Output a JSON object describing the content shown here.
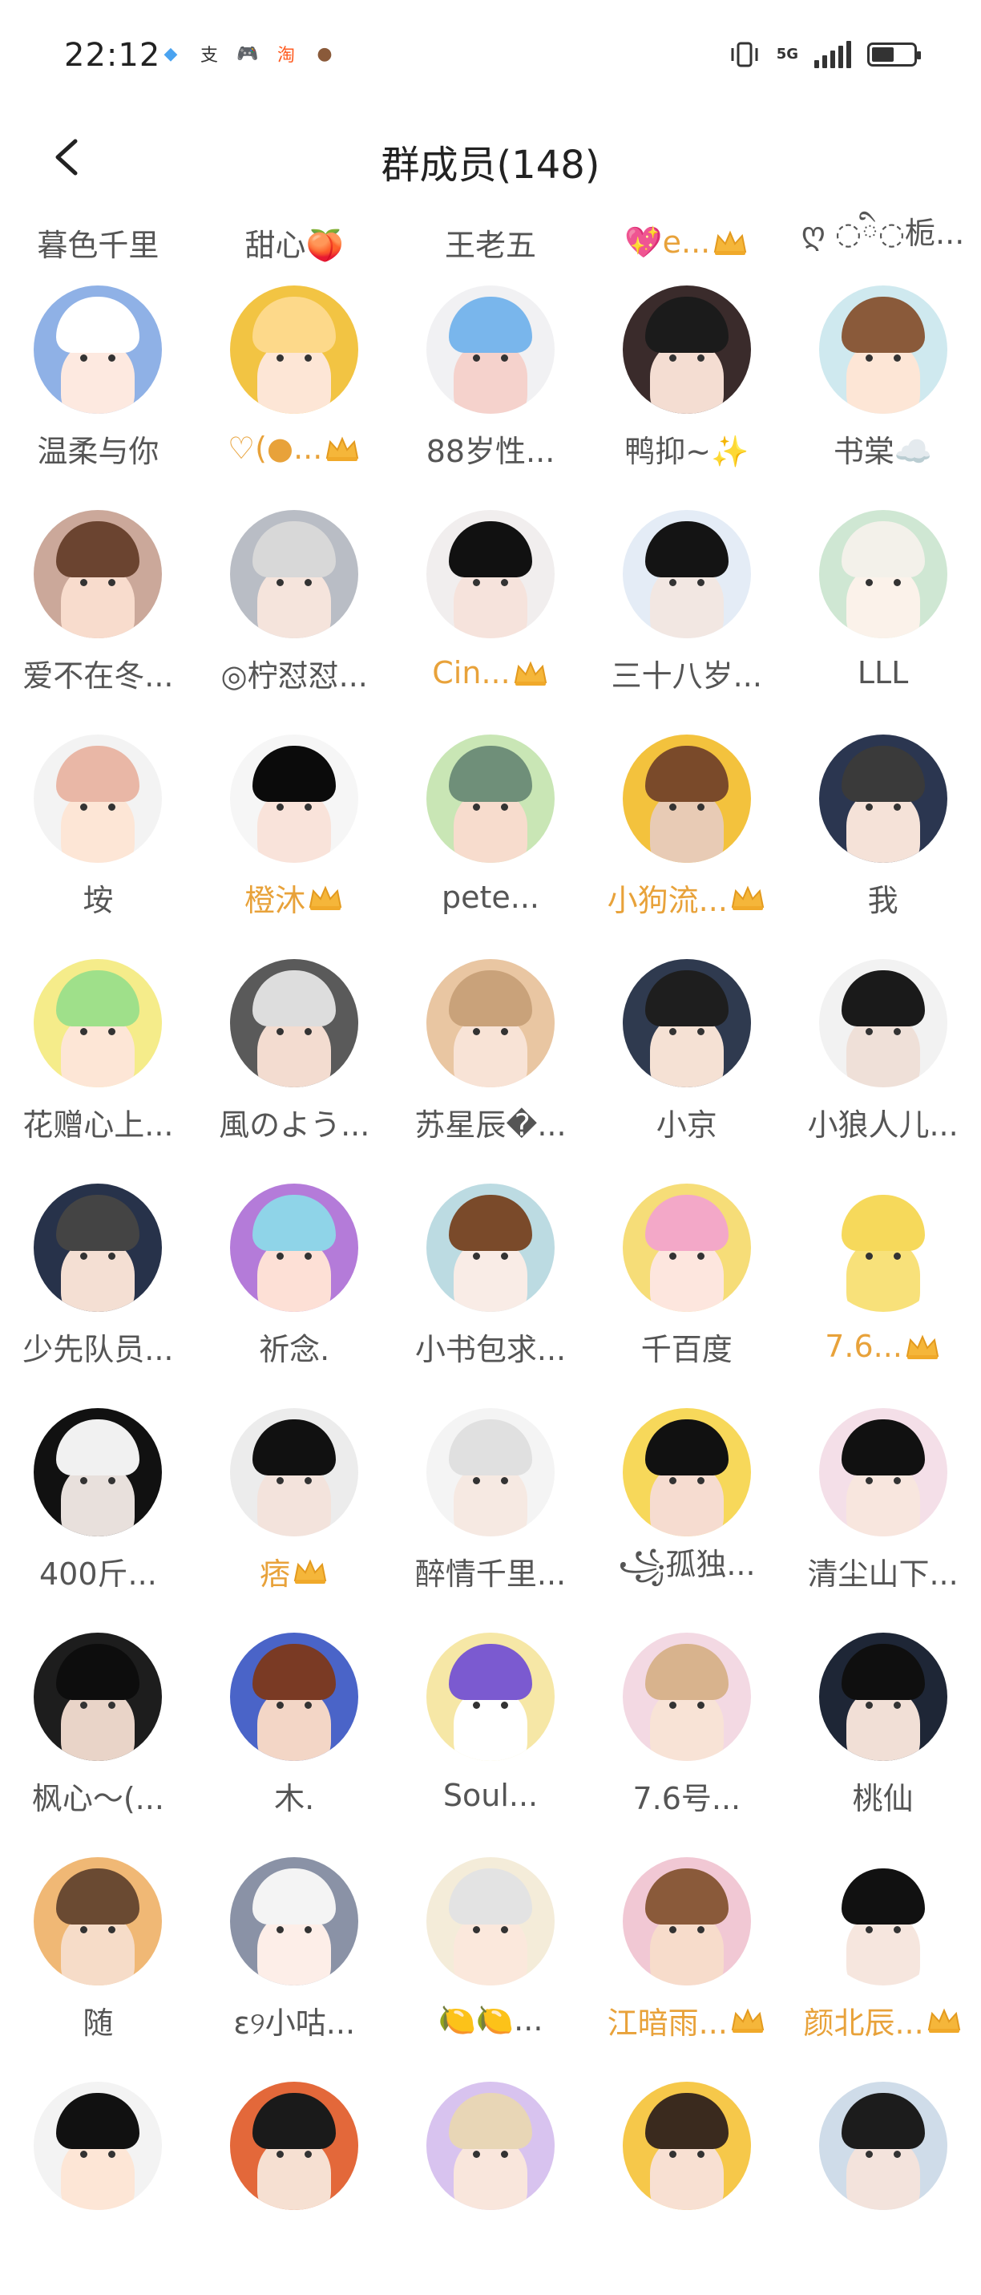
{
  "status": {
    "time": "22:12",
    "network": "5G",
    "apps": [
      {
        "icon": "alipay-mini-icon",
        "glyph": "◆",
        "color": "#4aa3f0"
      },
      {
        "icon": "alipay-icon",
        "glyph": "支",
        "color": "#333333"
      },
      {
        "icon": "game-icon",
        "glyph": "🎮",
        "color": "#6aa8e8"
      },
      {
        "icon": "taobao-icon",
        "glyph": "淘",
        "color": "#ff5a1f"
      },
      {
        "icon": "app-icon",
        "glyph": "●",
        "color": "#8a5a3a"
      }
    ]
  },
  "header": {
    "title": "群成员(148)"
  },
  "top_row": [
    {
      "name": "暮色千里",
      "vip": false
    },
    {
      "name": "甜心🍑",
      "vip": false
    },
    {
      "name": "王老五",
      "vip": false
    },
    {
      "name": "💖e...",
      "vip": true
    },
    {
      "name": "ღ ◌ི◌栀...",
      "vip": false
    }
  ],
  "rows": [
    [
      {
        "name": "温柔与你",
        "vip": false,
        "bg": "#8fb1e6",
        "hair": "#ffffff",
        "skin": "#fde9e0"
      },
      {
        "name": "♡(●...",
        "vip": true,
        "bg": "#f2c443",
        "hair": "#fdd98a",
        "skin": "#fde6d6"
      },
      {
        "name": "88岁性...",
        "vip": false,
        "bg": "#f1f1f3",
        "hair": "#79b6ec",
        "skin": "#f5d2cc"
      },
      {
        "name": "鸭抑~✨",
        "vip": false,
        "bg": "#3a2b2b",
        "hair": "#1b1b1b",
        "skin": "#f4ddd2"
      },
      {
        "name": "书棠☁️",
        "vip": false,
        "bg": "#cfe9ef",
        "hair": "#8a5a3a",
        "skin": "#fde6d6"
      }
    ],
    [
      {
        "name": "爱不在冬...",
        "vip": false,
        "bg": "#cba89a",
        "hair": "#6b4430",
        "skin": "#f8dccd"
      },
      {
        "name": "◎柠怼怼...",
        "vip": false,
        "bg": "#b9bdc5",
        "hair": "#d8d8d8",
        "skin": "#f5e4dc"
      },
      {
        "name": "Cin...",
        "vip": true,
        "bg": "#f1eeee",
        "hair": "#111111",
        "skin": "#f6e3dc"
      },
      {
        "name": "三十八岁...",
        "vip": false,
        "bg": "#e4ecf6",
        "hair": "#141414",
        "skin": "#f2e7e2"
      },
      {
        "name": "LLL",
        "vip": false,
        "bg": "#cfe7d3",
        "hair": "#f3f1ea",
        "skin": "#fbf2ea"
      }
    ],
    [
      {
        "name": "垵",
        "vip": false,
        "bg": "#f3f3f3",
        "hair": "#e9b7a6",
        "skin": "#fde6d6"
      },
      {
        "name": "橙沐",
        "vip": true,
        "bg": "#f6f6f6",
        "hair": "#0b0b0b",
        "skin": "#f9e3da"
      },
      {
        "name": "pete...",
        "vip": false,
        "bg": "#c9e6b5",
        "hair": "#6f8f79",
        "skin": "#f7dccd"
      },
      {
        "name": "小狗流...",
        "vip": true,
        "bg": "#f3c23d",
        "hair": "#7a4a2a",
        "skin": "#e8cbb5"
      },
      {
        "name": "我",
        "vip": false,
        "bg": "#2b3650",
        "hair": "#3a3a3a",
        "skin": "#f5e2d8"
      }
    ],
    [
      {
        "name": "花赠心上...",
        "vip": false,
        "bg": "#f5ec8a",
        "hair": "#9fe08a",
        "skin": "#fde6d6"
      },
      {
        "name": "風のよう...",
        "vip": false,
        "bg": "#5a5a5a",
        "hair": "#dddddd",
        "skin": "#f3dcd0"
      },
      {
        "name": "苏星辰�...",
        "vip": false,
        "bg": "#e9c6a2",
        "hair": "#c9a27a",
        "skin": "#f8e3d6"
      },
      {
        "name": "小京",
        "vip": false,
        "bg": "#2f3a4f",
        "hair": "#1e1e1e",
        "skin": "#f5e1d4"
      },
      {
        "name": "小狼人儿...",
        "vip": false,
        "bg": "#f2f2f2",
        "hair": "#1a1a1a",
        "skin": "#efe0d8"
      }
    ],
    [
      {
        "name": "少先队员...",
        "vip": false,
        "bg": "#27324a",
        "hair": "#444444",
        "skin": "#f4dfd3"
      },
      {
        "name": "祈念.",
        "vip": false,
        "bg": "#b47bd9",
        "hair": "#8fd4e8",
        "skin": "#fde0d6"
      },
      {
        "name": "小书包求...",
        "vip": false,
        "bg": "#bcdbe2",
        "hair": "#7a4a2a",
        "skin": "#f9ece6"
      },
      {
        "name": "千百度",
        "vip": false,
        "bg": "#f6dd78",
        "hair": "#f3a8c8",
        "skin": "#fde6de"
      },
      {
        "name": "7.6...",
        "vip": true,
        "bg": "#ffffff",
        "hair": "#f6d95b",
        "skin": "#f8e17a"
      }
    ],
    [
      {
        "name": "400斤...",
        "vip": false,
        "bg": "#111111",
        "hair": "#f1f1f1",
        "skin": "#e8e0dc"
      },
      {
        "name": "痞",
        "vip": true,
        "bg": "#ececec",
        "hair": "#111111",
        "skin": "#f3e3dc"
      },
      {
        "name": "醉情千里...",
        "vip": false,
        "bg": "#f4f4f4",
        "hair": "#e0e0e0",
        "skin": "#f6e9e2"
      },
      {
        "name": "꧁孤独...",
        "vip": false,
        "bg": "#f7d85a",
        "hair": "#111111",
        "skin": "#f6dcd0"
      },
      {
        "name": "清尘山下...",
        "vip": false,
        "bg": "#f4dfe8",
        "hair": "#111111",
        "skin": "#f8e6de"
      }
    ],
    [
      {
        "name": "枫心～(...",
        "vip": false,
        "bg": "#1d1d1d",
        "hair": "#0d0d0d",
        "skin": "#e9d4c8"
      },
      {
        "name": "木.",
        "vip": false,
        "bg": "#4a64c8",
        "hair": "#7a3a24",
        "skin": "#f3d6c6"
      },
      {
        "name": "Soul...",
        "vip": false,
        "bg": "#f6e7a6",
        "hair": "#7b5ad0",
        "skin": "#ffffff"
      },
      {
        "name": "7.6号...",
        "vip": false,
        "bg": "#f3d9e3",
        "hair": "#d8b38d",
        "skin": "#f8e3d6"
      },
      {
        "name": "桃仙",
        "vip": false,
        "bg": "#1e2636",
        "hair": "#0f0f0f",
        "skin": "#f1dfd6"
      }
    ],
    [
      {
        "name": "随",
        "vip": false,
        "bg": "#f0b875",
        "hair": "#6a4a32",
        "skin": "#f6dcc8"
      },
      {
        "name": "ɛ୨小咕...",
        "vip": false,
        "bg": "#8a92a6",
        "hair": "#f4f4f4",
        "skin": "#fdeee8"
      },
      {
        "name": "🍋🍋...",
        "vip": false,
        "bg": "#f4ecd9",
        "hair": "#e3e3e3",
        "skin": "#fbe8dc"
      },
      {
        "name": "江暗雨...",
        "vip": true,
        "bg": "#f1c8d4",
        "hair": "#8a5a3a",
        "skin": "#f7dccb"
      },
      {
        "name": "颜北辰...",
        "vip": true,
        "bg": "#ffffff",
        "hair": "#111111",
        "skin": "#f6e6de"
      }
    ],
    [
      {
        "name": "",
        "vip": false,
        "bg": "#f3f3f3",
        "hair": "#111111",
        "skin": "#fde6d6"
      },
      {
        "name": "",
        "vip": false,
        "bg": "#e3683a",
        "hair": "#1a1a1a",
        "skin": "#f6e0d2"
      },
      {
        "name": "",
        "vip": false,
        "bg": "#d8c3ef",
        "hair": "#e8d6b6",
        "skin": "#f9e6dc"
      },
      {
        "name": "",
        "vip": false,
        "bg": "#f6c84a",
        "hair": "#3a2a1e",
        "skin": "#f8e0d2"
      },
      {
        "name": "",
        "vip": false,
        "bg": "#cfdce9",
        "hair": "#1c1c1c",
        "skin": "#f3e3dc"
      }
    ]
  ]
}
